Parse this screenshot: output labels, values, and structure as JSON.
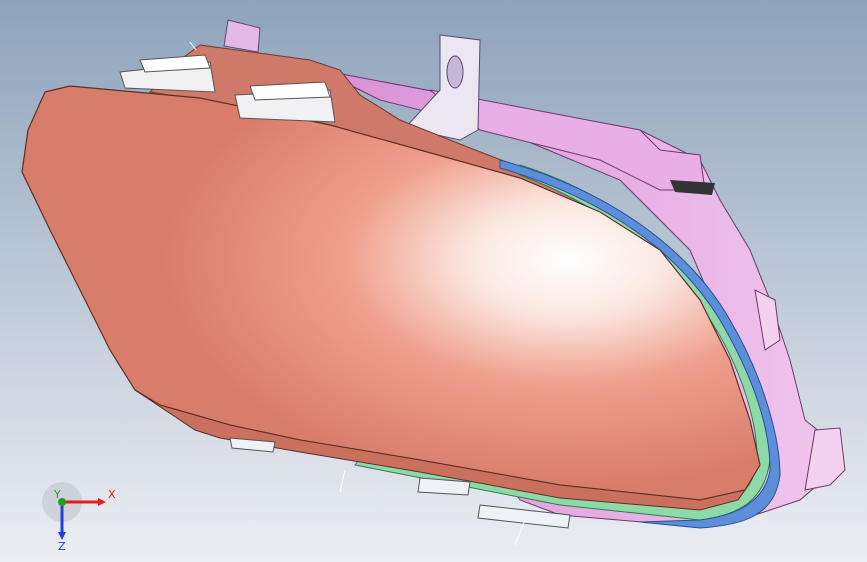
{
  "viewport": {
    "background_top": "#8ea3bb",
    "background_bottom": "#eceef3"
  },
  "model": {
    "lens_color": "#e8907f",
    "housing_color": "#e6a2e0",
    "seal_green": "#8ed9a8",
    "seal_blue": "#5d8ed9",
    "bracket_color": "#e9ecef"
  },
  "triad": {
    "x_label": "X",
    "y_label": "Y",
    "z_label": "Z",
    "x_color": "#e02020",
    "y_color": "#20a020",
    "z_color": "#2040e0"
  }
}
